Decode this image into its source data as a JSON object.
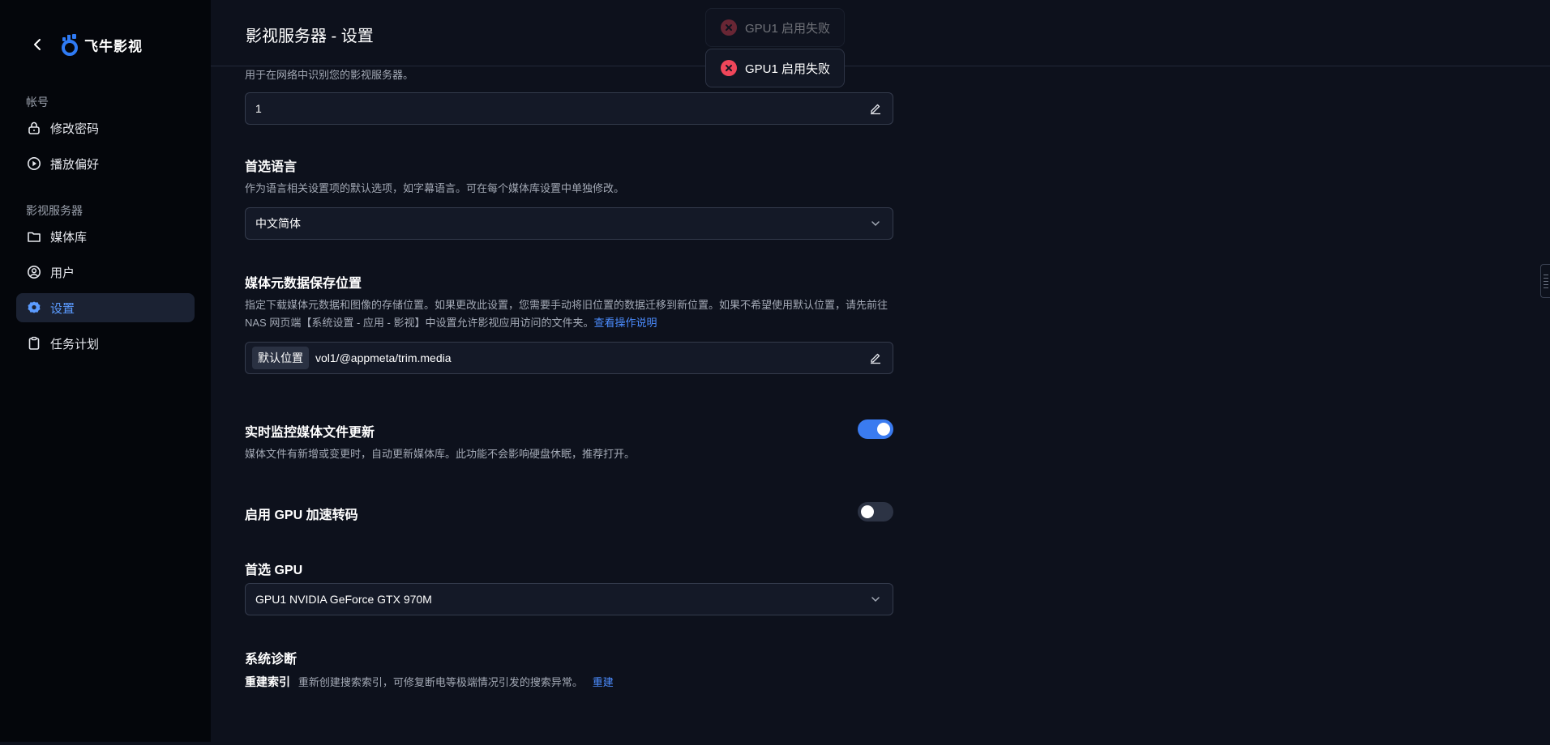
{
  "app": {
    "name": "飞牛影视"
  },
  "sidebar": {
    "sections": [
      {
        "title": "帐号",
        "items": [
          {
            "label": "修改密码",
            "icon": "lock-icon"
          },
          {
            "label": "播放偏好",
            "icon": "play-circle-icon"
          }
        ]
      },
      {
        "title": "影视服务器",
        "items": [
          {
            "label": "媒体库",
            "icon": "folder-icon"
          },
          {
            "label": "用户",
            "icon": "user-circle-icon"
          },
          {
            "label": "设置",
            "icon": "gear-icon",
            "active": true
          },
          {
            "label": "任务计划",
            "icon": "clipboard-icon"
          }
        ]
      }
    ]
  },
  "header": {
    "title": "影视服务器 - 设置"
  },
  "toasts": [
    {
      "message": "GPU1 启用失败"
    },
    {
      "message": "GPU1 启用失败"
    }
  ],
  "settings": {
    "server_name": {
      "description": "用于在网络中识别您的影视服务器。",
      "value": "1"
    },
    "language": {
      "title": "首选语言",
      "description": "作为语言相关设置项的默认选项，如字幕语言。可在每个媒体库设置中单独修改。",
      "value": "中文简体"
    },
    "metadata_path": {
      "title": "媒体元数据保存位置",
      "description_line1": "指定下载媒体元数据和图像的存储位置。如果更改此设置，您需要手动将旧位置的数据迁移到新位置。如果不希望使用默认位置，请先前往",
      "description_line2": "NAS 网页端【系统设置 - 应用 - 影视】中设置允许影视应用访问的文件夹。",
      "help_link": "查看操作说明",
      "tag": "默认位置",
      "value": "vol1/@appmeta/trim.media"
    },
    "realtime_monitor": {
      "title": "实时监控媒体文件更新",
      "description": "媒体文件有新增或变更时，自动更新媒体库。此功能不会影响硬盘休眠，推荐打开。",
      "enabled": true
    },
    "gpu_transcode": {
      "title": "启用 GPU 加速转码",
      "enabled": false
    },
    "preferred_gpu": {
      "title": "首选 GPU",
      "value": "GPU1 NVIDIA GeForce GTX 970M"
    },
    "diagnostics": {
      "title": "系统诊断",
      "reindex_label": "重建索引",
      "reindex_description": "重新创建搜索索引，可修复断电等极端情况引发的搜索异常。",
      "reindex_action": "重建"
    }
  },
  "colors": {
    "accent": "#3a7bf0",
    "link": "#4c8dff",
    "error": "#f0465a",
    "background": "#0d111c",
    "sidebar": "#04060b"
  }
}
